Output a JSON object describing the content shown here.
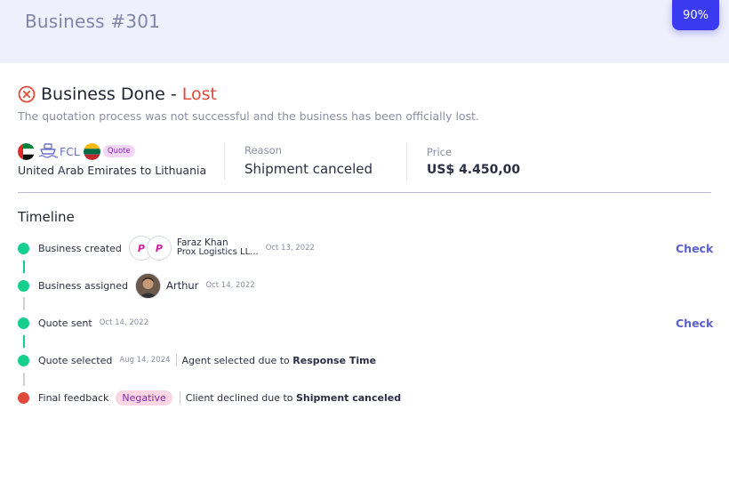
{
  "header": {
    "title": "Business #301",
    "progress": "90%"
  },
  "status": {
    "title": "Business Done -",
    "outcome": "Lost",
    "description": "The quotation process was not successful and the business has been officially lost."
  },
  "shipment": {
    "mode": "FCL",
    "tag": "Quote",
    "route": "United Arab Emirates to Lithuania"
  },
  "reason": {
    "label": "Reason",
    "value": "Shipment canceled"
  },
  "price": {
    "label": "Price",
    "value": "US$ 4.450,00"
  },
  "timeline": {
    "title": "Timeline",
    "events": [
      {
        "label": "Business created",
        "person_name": "Faraz Khan",
        "person_company": "Prox Logistics LL...",
        "date": "Oct 13, 2022",
        "action": "Check"
      },
      {
        "label": "Business assigned",
        "person_name": "Arthur",
        "date": "Oct 14, 2022"
      },
      {
        "label": "Quote sent",
        "date": "Oct 14, 2022",
        "action": "Check"
      },
      {
        "label": "Quote selected",
        "date": "Aug 14, 2024",
        "detail_prefix": "Agent selected due to",
        "detail_value": "Response Time"
      },
      {
        "label": "Final feedback",
        "badge": "Negative",
        "detail_prefix": "Client declined due to",
        "detail_value": "Shipment canceled"
      }
    ]
  },
  "colors": {
    "accent": "#3a3af0",
    "lost": "#e04a3a",
    "success_dot": "#16cf8f",
    "link": "#5b61d4"
  }
}
